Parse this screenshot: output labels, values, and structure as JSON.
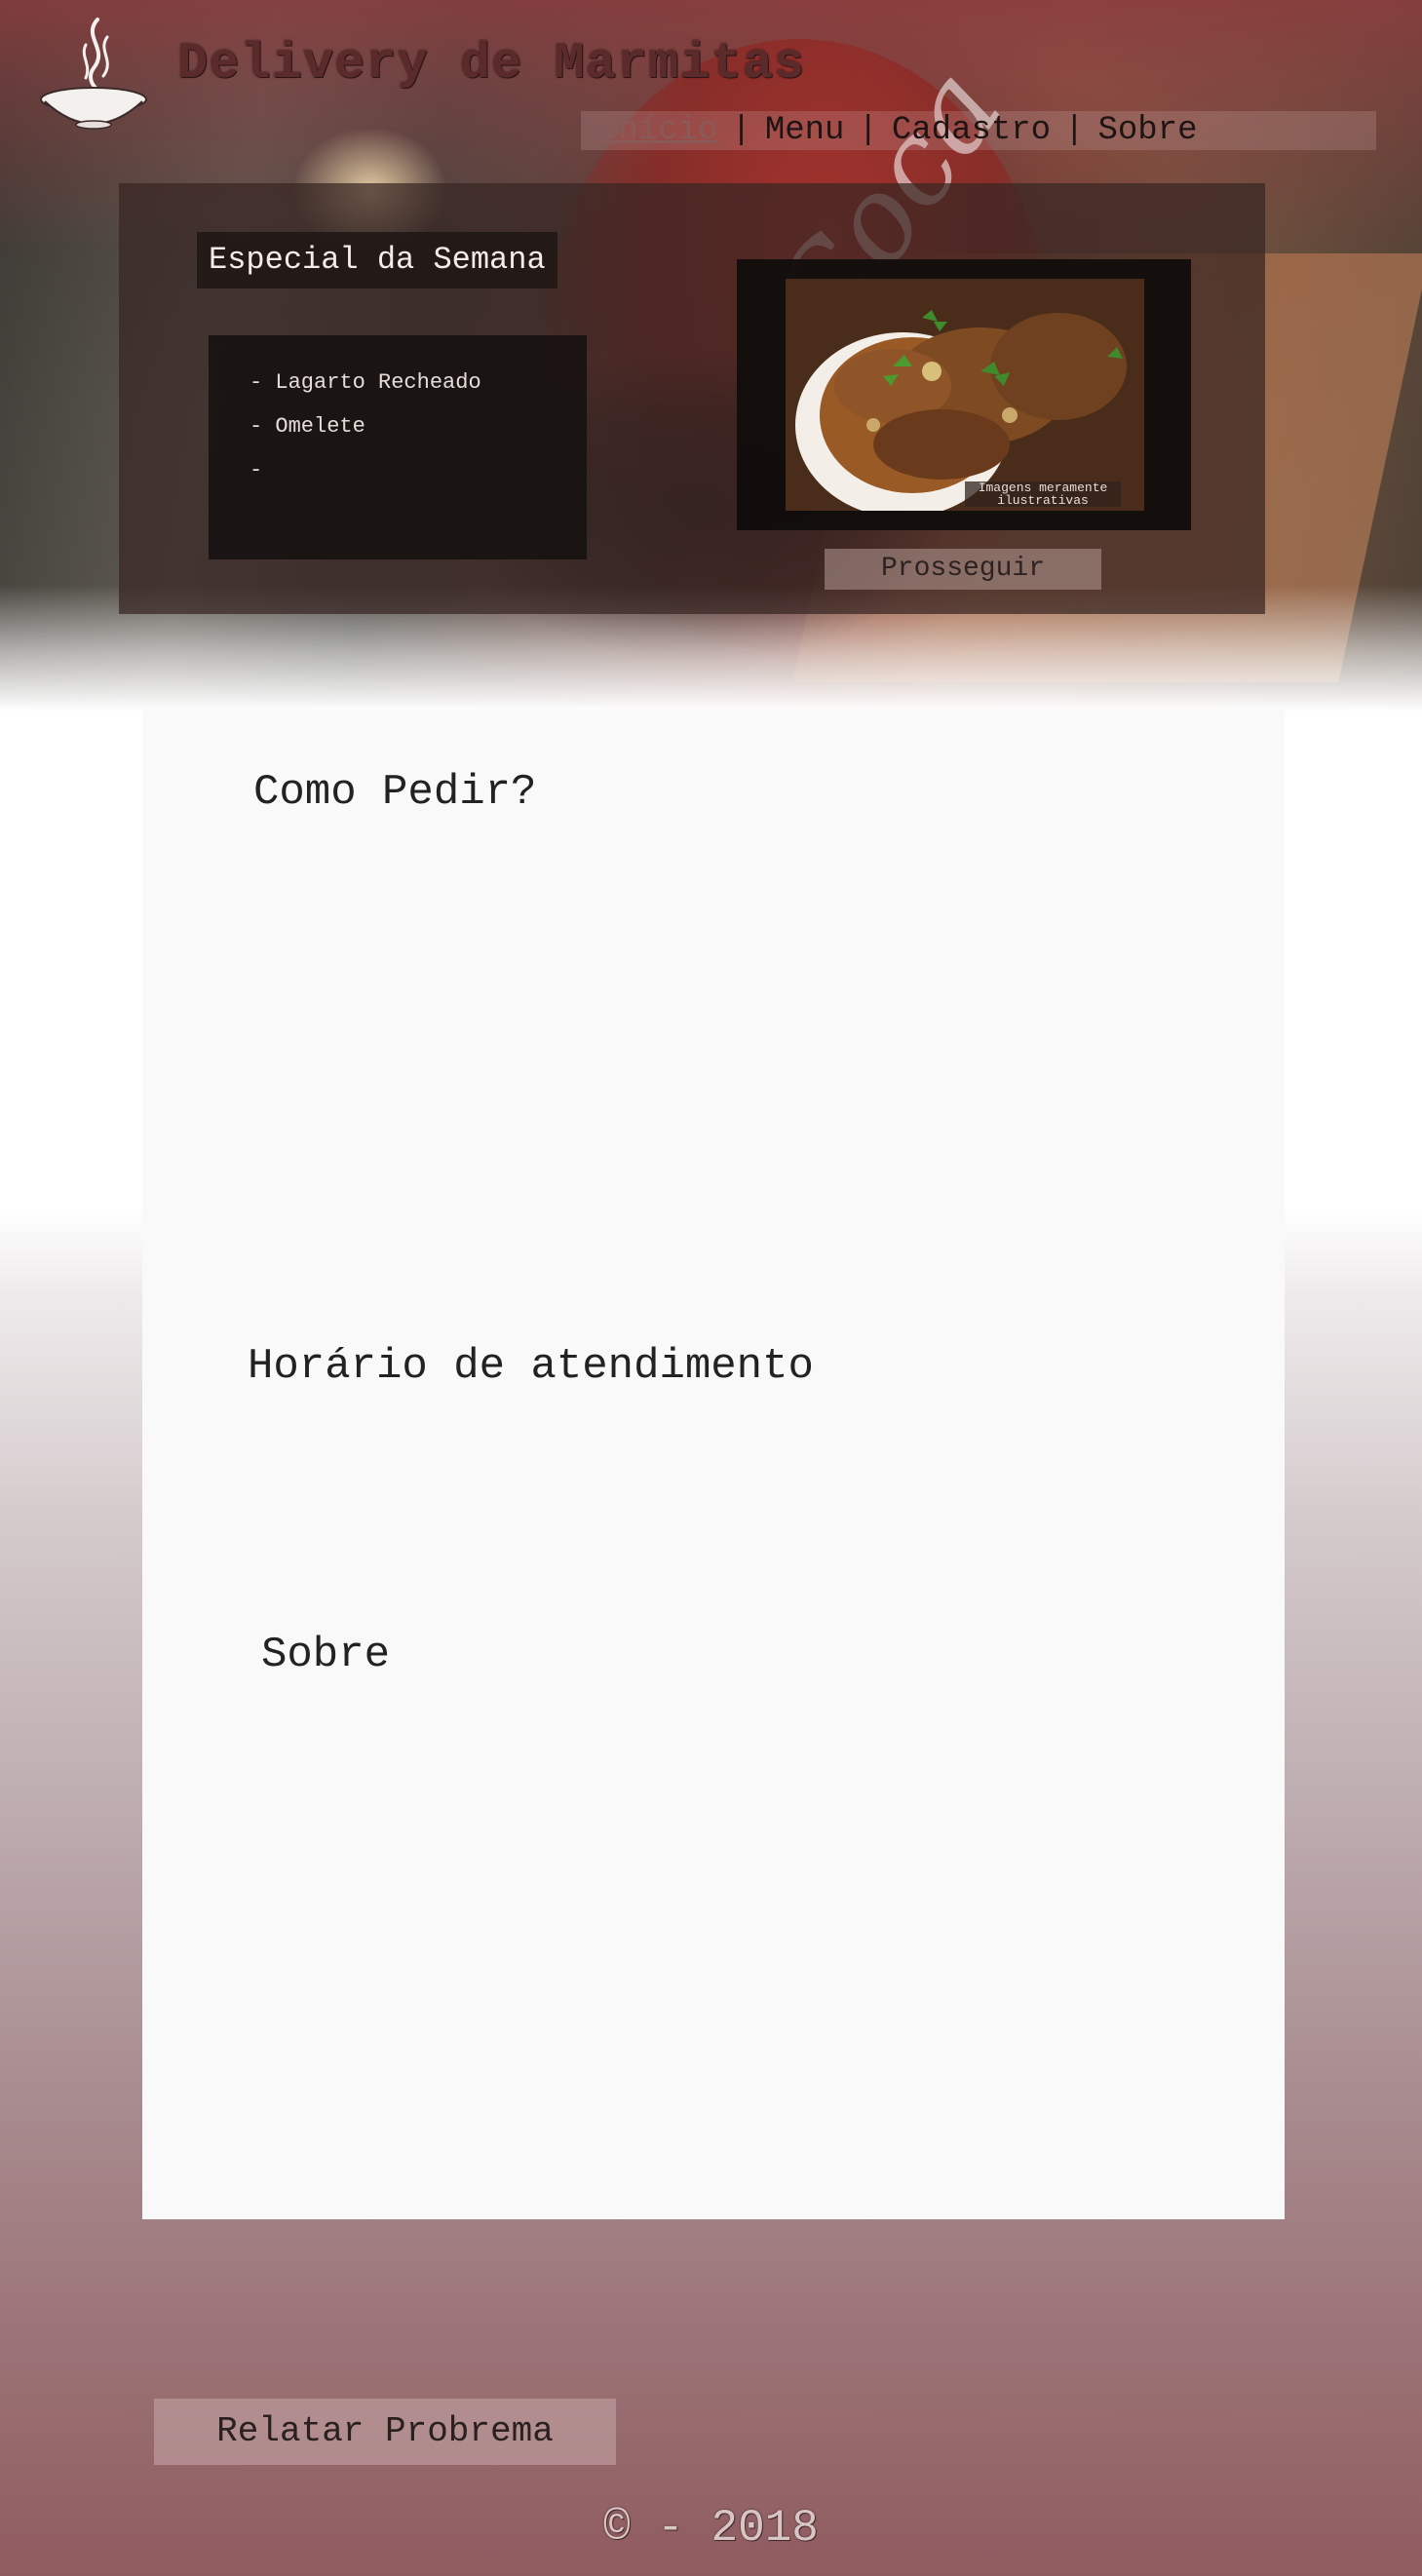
{
  "header": {
    "site_title": "Delivery de Marmitas",
    "logo_icon": "steaming-bowl-icon"
  },
  "nav": {
    "items": [
      {
        "label": "Início",
        "active": true
      },
      {
        "label": "Menu",
        "active": false
      },
      {
        "label": "Cadastro",
        "active": false
      },
      {
        "label": "Sobre",
        "active": false
      }
    ],
    "separator": "|"
  },
  "special": {
    "title": "Especial da Semana",
    "items": [
      "Lagarto Recheado",
      "Omelete",
      ""
    ],
    "photo_caption": "Imagens meramente ilustrativas",
    "proceed_label": "Prosseguir"
  },
  "sections": {
    "como_pedir": "Como Pedir?",
    "horario": "Horário de atendimento",
    "sobre": "Sobre"
  },
  "footer": {
    "report_label": "Relatar Probrema",
    "copyright": "© - 2018"
  },
  "colors": {
    "header_tint": "#8c3c3e",
    "card_bg": "#f9f9f9",
    "footer_bottom": "#8f5b5f",
    "title_text": "#5b2b2b"
  }
}
